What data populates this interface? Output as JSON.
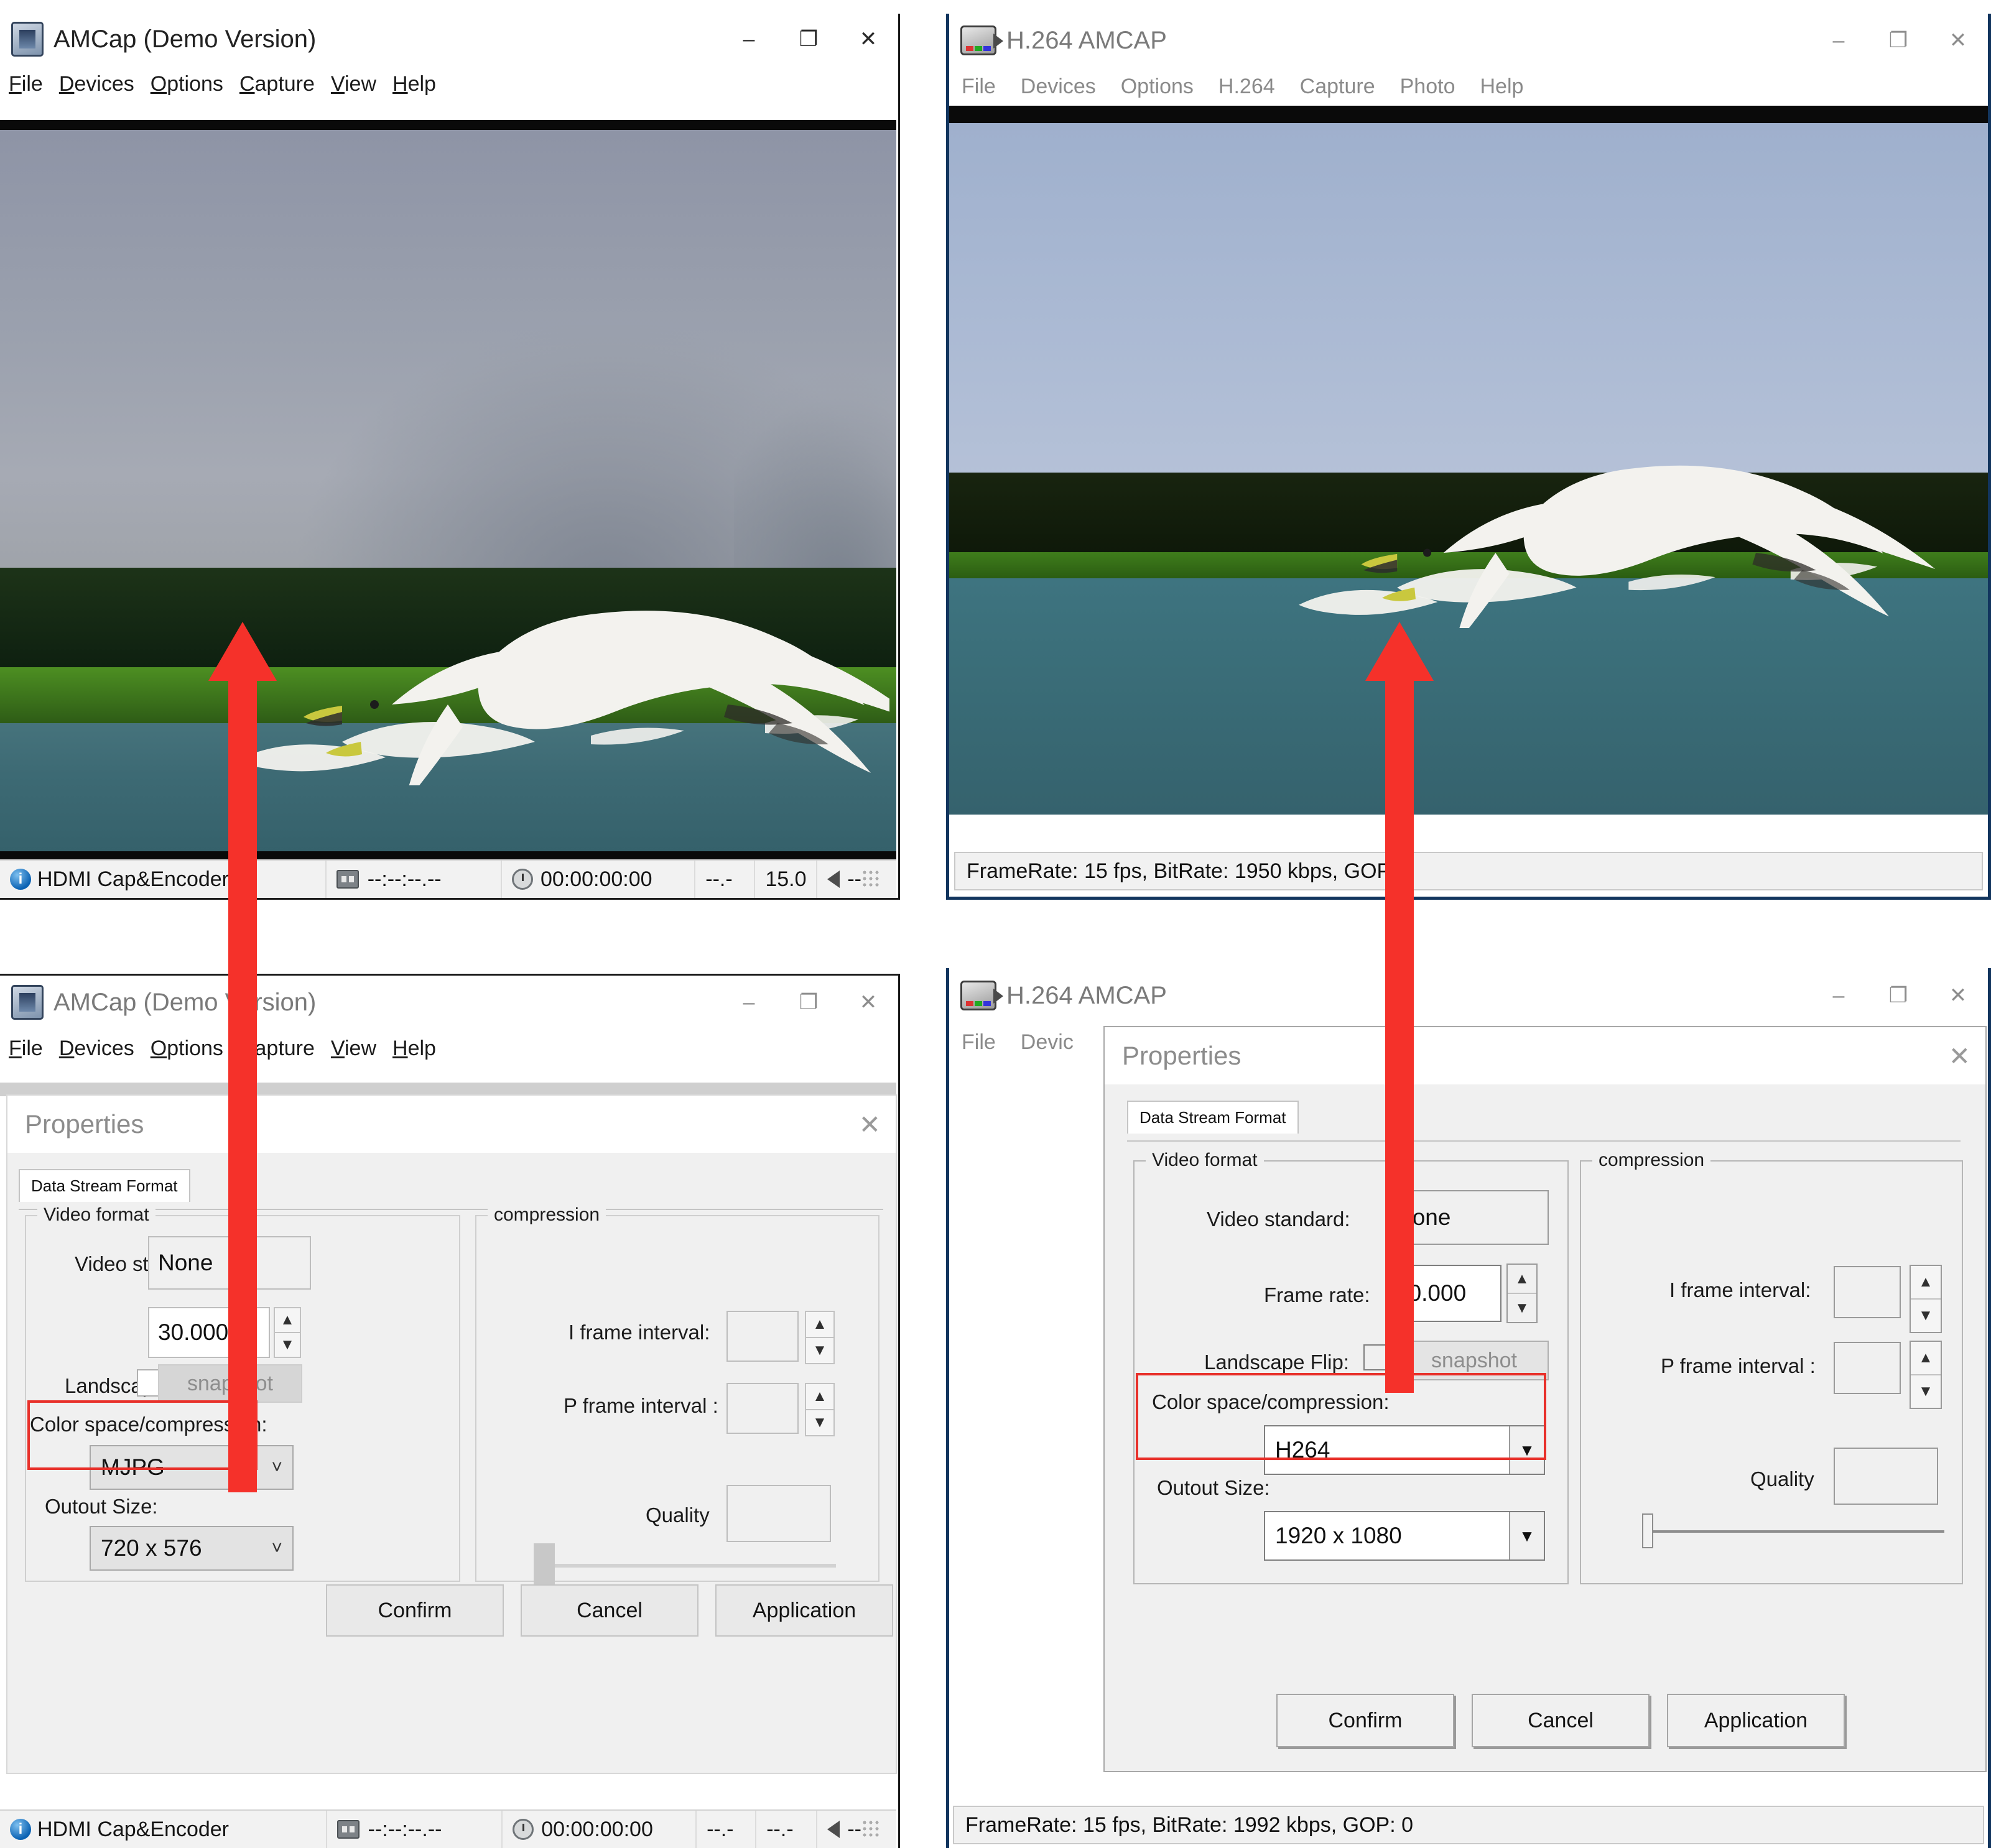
{
  "windows": {
    "top_left": {
      "title": "AMCap (Demo Version)",
      "icon": "camera-icon",
      "controls": {
        "minimize": "–",
        "maximize": "❐",
        "close": "✕"
      },
      "menu": [
        {
          "acc": "F",
          "rest": "ile"
        },
        {
          "acc": "D",
          "rest": "evices"
        },
        {
          "acc": "O",
          "rest": "ptions"
        },
        {
          "acc": "C",
          "rest": "apture"
        },
        {
          "acc": "V",
          "rest": "iew"
        },
        {
          "acc": "H",
          "rest": "elp"
        }
      ],
      "status": {
        "device": "HDMI Cap&Encoder",
        "timecode_dashes": "--:--:--.--",
        "timecode": "00:00:00:00",
        "rate_dashes": "--.-",
        "fps": "15.0",
        "volume": "--"
      }
    },
    "top_right": {
      "title": "H.264 AMCAP",
      "icon": "camcorder-icon",
      "controls": {
        "minimize": "–",
        "maximize": "❐",
        "close": "✕"
      },
      "menu": [
        "File",
        "Devices",
        "Options",
        "H.264",
        "Capture",
        "Photo",
        "Help"
      ],
      "status": "FrameRate: 15 fps, BitRate: 1950 kbps, GOP: 0"
    },
    "bottom_left": {
      "title": "AMCap (Demo Version)",
      "icon": "camera-icon",
      "controls": {
        "minimize": "–",
        "maximize": "❐",
        "close": "✕"
      },
      "menu": [
        {
          "acc": "F",
          "rest": "ile"
        },
        {
          "acc": "D",
          "rest": "evices"
        },
        {
          "acc": "O",
          "rest": "ptions"
        },
        {
          "acc": "C",
          "rest": "apture"
        },
        {
          "acc": "V",
          "rest": "iew"
        },
        {
          "acc": "H",
          "rest": "elp"
        }
      ],
      "status": {
        "device": "HDMI Cap&Encoder",
        "timecode_dashes": "--:--:--.--",
        "timecode": "00:00:00:00",
        "rate_dashes": "--.-",
        "fps": "--.-",
        "volume": "--"
      }
    },
    "bottom_right": {
      "title": "H.264 AMCAP",
      "icon": "camcorder-icon",
      "controls": {
        "minimize": "–",
        "maximize": "❐",
        "close": "✕"
      },
      "menu": [
        "File",
        "Devic"
      ],
      "status": "FrameRate: 15 fps, BitRate: 1992 kbps, GOP: 0"
    }
  },
  "dialog_left": {
    "title": "Properties",
    "close": "✕",
    "tab": "Data Stream Format",
    "video_format": {
      "legend": "Video format",
      "video_standard_label": "Video standard:",
      "video_standard_value": "None",
      "frame_rate_value": "30.000",
      "landscape_flip_label": "Landscape Flip:",
      "snapshot_label": "snapshot",
      "color_space_label": "Color space/compression:",
      "color_space_value": "MJPG",
      "output_size_label": "Outout Size:",
      "output_size_value": "720 x 576"
    },
    "compression": {
      "legend": "compression",
      "i_frame_label": "I frame interval:",
      "i_frame_value": "",
      "p_frame_label": "P frame interval :",
      "p_frame_value": "",
      "quality_label": "Quality",
      "quality_value": ""
    },
    "buttons": {
      "confirm": "Confirm",
      "cancel": "Cancel",
      "application": "Application"
    }
  },
  "dialog_right": {
    "title": "Properties",
    "close": "✕",
    "tab": "Data Stream Format",
    "video_format": {
      "legend": "Video format",
      "video_standard_label": "Video standard:",
      "video_standard_value": "None",
      "frame_rate_label": "Frame rate:",
      "frame_rate_value": "30.000",
      "landscape_flip_label": "Landscape Flip:",
      "snapshot_label": "snapshot",
      "color_space_label": "Color space/compression:",
      "color_space_value": "H264",
      "output_size_label": "Outout Size:",
      "output_size_value": "1920 x 1080"
    },
    "compression": {
      "legend": "compression",
      "i_frame_label": "I frame interval:",
      "i_frame_value": "",
      "p_frame_label": "P frame interval :",
      "p_frame_value": "",
      "quality_label": "Quality",
      "quality_value": ""
    },
    "buttons": {
      "confirm": "Confirm",
      "cancel": "Cancel",
      "application": "Application"
    }
  },
  "annotations": {
    "highlight_color": "#e8302a",
    "arrow_color": "#f5312a",
    "arrow_count": 2,
    "arrow_note": "red upward arrows linking video preview to the color space/compression setting"
  },
  "colors": {
    "window_border_navy": "#12355e",
    "dialog_bg": "#f0f0f0",
    "video_sky": "#9aa0ae",
    "video_water": "#3f6f78",
    "video_grass": "#3f7a1f",
    "accent_red": "#e8302a"
  }
}
